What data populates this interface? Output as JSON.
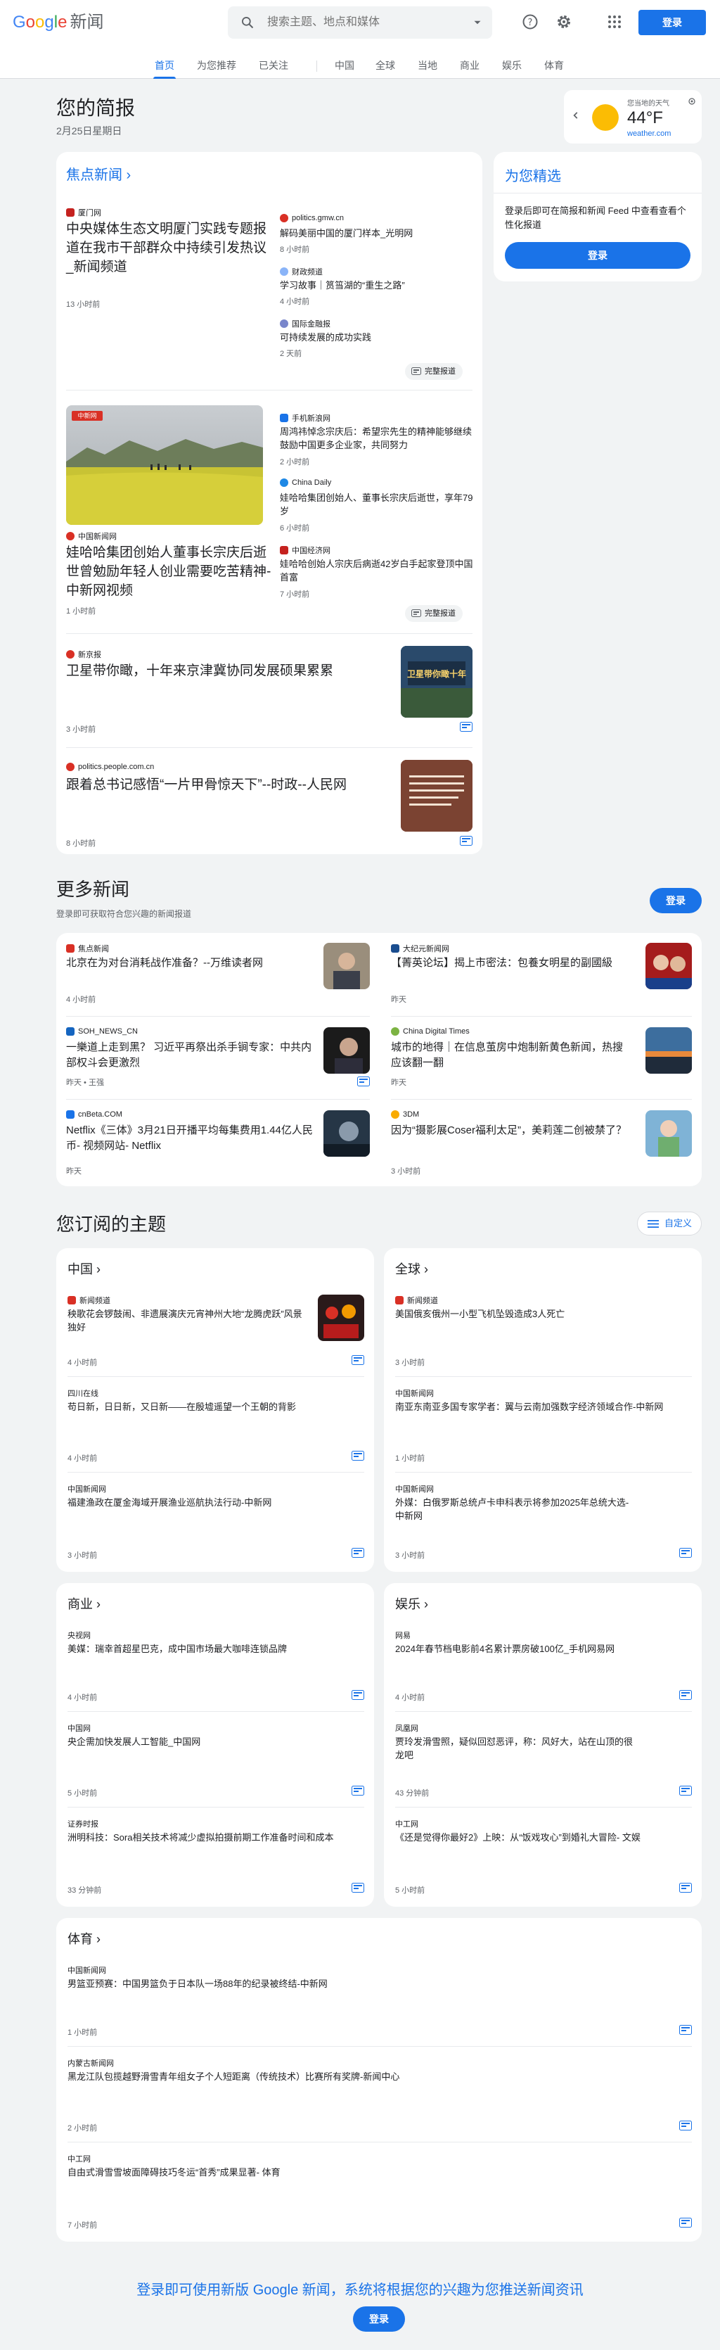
{
  "header": {
    "logo": {
      "g": "G",
      "o1": "o",
      "o2": "o",
      "g2": "g",
      "l": "l",
      "e": "e",
      "news": "新闻"
    },
    "search_placeholder": "搜索主题、地点和媒体",
    "signin": "登录"
  },
  "tabs": [
    "首页",
    "为您推荐",
    "已关注",
    "中国",
    "全球",
    "当地",
    "商业",
    "娱乐",
    "体育"
  ],
  "briefing": {
    "title": "您的简报",
    "date": "2月25日星期日"
  },
  "weather": {
    "label": "您当地的天气",
    "temp": "44°F",
    "source": "weather.com"
  },
  "top": {
    "heading": "焦点新闻",
    "full_coverage": "完整报道",
    "cluster1": {
      "main": {
        "source": "厦门网",
        "title": "中央媒体生态文明厦门实践专题报道在我市干部群众中持续引发热议_新闻频道",
        "time": "13 小时前"
      },
      "side": [
        {
          "source": "politics.gmw.cn",
          "title": "解码美丽中国的厦门样本_光明网",
          "time": "8 小时前"
        },
        {
          "source": "财政频道",
          "title": "学习故事｜筼筜湖的“重生之路”",
          "time": "4 小时前"
        },
        {
          "source": "国际金融报",
          "title": "可持续发展的成功实践",
          "time": "2 天前"
        }
      ]
    },
    "cluster2": {
      "main": {
        "source": "中国新闻网",
        "title": "娃哈哈集团创始人董事长宗庆后逝世曾勉励年轻人创业需要吃苦精神-中新网视频",
        "time": "1 小时前"
      },
      "side": [
        {
          "source": "手机新浪网",
          "title": "周鸿祎悼念宗庆后：希望宗先生的精神能够继续鼓励中国更多企业家，共同努力",
          "time": "2 小时前"
        },
        {
          "source": "China Daily",
          "title": "娃哈哈集团创始人、董事长宗庆后逝世，享年79岁",
          "time": "6 小时前"
        },
        {
          "source": "中国经济网",
          "title": "娃哈哈创始人宗庆后病逝42岁白手起家登顶中国首富",
          "time": "7 小时前"
        }
      ]
    },
    "single": [
      {
        "source": "新京报",
        "title": "卫星带你瞰，十年来京津冀协同发展硕果累累",
        "time": "3 小时前",
        "thumb_text": "卫星带你瞰十年"
      },
      {
        "source": "politics.people.com.cn",
        "title": "跟着总书记感悟“一片甲骨惊天下”--时政--人民网",
        "time": "8 小时前"
      }
    ]
  },
  "picks": {
    "heading": "为您精选",
    "text": "登录后即可在简报和新闻 Feed 中查看查看个性化报道",
    "button": "登录"
  },
  "more": {
    "title": "更多新闻",
    "subtitle": "登录即可获取符合您兴趣的新闻报道",
    "button": "登录",
    "items": [
      {
        "source": "焦点新闻",
        "title": "北京在为对台消耗战作准备？--万维读者网",
        "time": "4 小时前"
      },
      {
        "source": "大纪元新闻网",
        "title": "【菁英论坛】揭上市密法：包養女明星的副國級",
        "time": "昨天"
      },
      {
        "source": "SOH_NEWS_CN",
        "title": "一樂道上走到黑？ 习近平再祭出杀手锏专家：中共内部权斗会更激烈",
        "time": "昨天 • 王强"
      },
      {
        "source": "China Digital Times",
        "title": "城市的地得｜在信息茧房中炮制新黄色新闻，热搜应该翻一翻",
        "time": "昨天"
      },
      {
        "source": "cnBeta.COM",
        "title": "Netflix《三体》3月21日开播平均每集费用1.44亿人民币- 视频网站- Netflix",
        "time": "昨天"
      },
      {
        "source": "3DM",
        "title": "因为“摄影展Coser福利太足”，美莉莲二创被禁了？",
        "time": "3 小时前"
      }
    ]
  },
  "topics": {
    "title": "您订阅的主题",
    "customize": "自定义",
    "china": {
      "name": "中国",
      "items": [
        {
          "source": "新闻频道",
          "title": "秧歌花会锣鼓闹、非遗展演庆元宵神州大地“龙腾虎跃”风景独好",
          "time": "4 小时前"
        },
        {
          "source": "四川在线",
          "title": "苟日新，日日新，又日新——在殷墟遥望一个王朝的背影",
          "time": "4 小时前"
        },
        {
          "source": "中国新闻网",
          "title": "福建渔政在厦金海域开展渔业巡航执法行动-中新网",
          "time": "3 小时前"
        }
      ]
    },
    "world": {
      "name": "全球",
      "items": [
        {
          "source": "新闻频道",
          "title": "美国俄亥俄州一小型飞机坠毁造成3人死亡",
          "time": "3 小时前"
        },
        {
          "source": "中国新闻网",
          "title": "南亚东南亚多国专家学者：翼与云南加强数字经济领域合作-中新网",
          "time": "1 小时前"
        },
        {
          "source": "中国新闻网",
          "title": "外媒：白俄罗斯总统卢卡申科表示将参加2025年总统大选-中新网",
          "time": "3 小时前"
        }
      ]
    },
    "business": {
      "name": "商业",
      "items": [
        {
          "source": "央视网",
          "title": "美媒：瑞幸首超星巴克，成中国市场最大咖啡连锁品牌",
          "time": "4 小时前"
        },
        {
          "source": "中国网",
          "title": "央企需加快发展人工智能_中国网",
          "time": "5 小时前"
        },
        {
          "source": "证券时报",
          "title": "洲明科技：Sora相关技术将减少虚拟拍摄前期工作准备时间和成本",
          "time": "33 分钟前"
        }
      ]
    },
    "ent": {
      "name": "娱乐",
      "items": [
        {
          "source": "网易",
          "title": "2024年春节档电影前4名累计票房破100亿_手机网易网",
          "time": "4 小时前"
        },
        {
          "source": "凤凰网",
          "title": "贾玲发滑雪照，疑似回怼恶评，称：风好大，站在山顶的很龙吧",
          "time": "43 分钟前"
        },
        {
          "source": "中工网",
          "title": "《还是觉得你最好2》上映：从“饭戏攻心”到婚礼大冒险- 文娱",
          "time": "5 小时前"
        }
      ]
    },
    "sports": {
      "name": "体育",
      "items": [
        {
          "source": "中国新闻网",
          "title": "男篮亚预赛：中国男篮负于日本队一场88年的纪录被终结-中新网",
          "time": "1 小时前"
        },
        {
          "source": "内蒙古新闻网",
          "title": "黑龙江队包揽越野滑雪青年组女子个人短距离（传统技术）比赛所有奖牌-新闻中心",
          "time": "2 小时前"
        },
        {
          "source": "中工网",
          "title": "自由式滑雪雪坡面障碍技巧冬运“首秀”成果显著- 体育",
          "time": "7 小时前"
        }
      ]
    }
  },
  "footer": {
    "text": "登录即可使用新版 Google 新闻，系统将根据您的兴趣为您推送新闻资讯",
    "button": "登录"
  }
}
